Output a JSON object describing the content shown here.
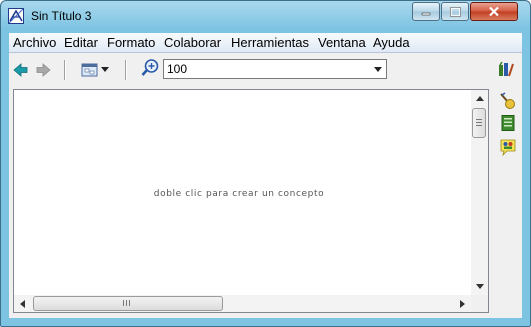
{
  "window": {
    "title": "Sin Título 3"
  },
  "menu": {
    "items": [
      "Archivo",
      "Editar",
      "Formato",
      "Colaborar",
      "Herramientas",
      "Ventana",
      "Ayuda"
    ]
  },
  "toolbar": {
    "icons": [
      "back-arrow-icon",
      "forward-arrow-icon",
      "view-style-icon",
      "zoom-icon",
      "style-palette-icon"
    ],
    "zoom_value": "100"
  },
  "canvas": {
    "hint": "doble clic para crear un concepto"
  },
  "side_panel": {
    "icons": [
      "resources-icon",
      "notes-icon",
      "collaborators-icon"
    ]
  },
  "colors": {
    "window_frame": "#7dc4e2",
    "close_button": "#c13e21",
    "arrow_teal": "#1b9aa8"
  }
}
